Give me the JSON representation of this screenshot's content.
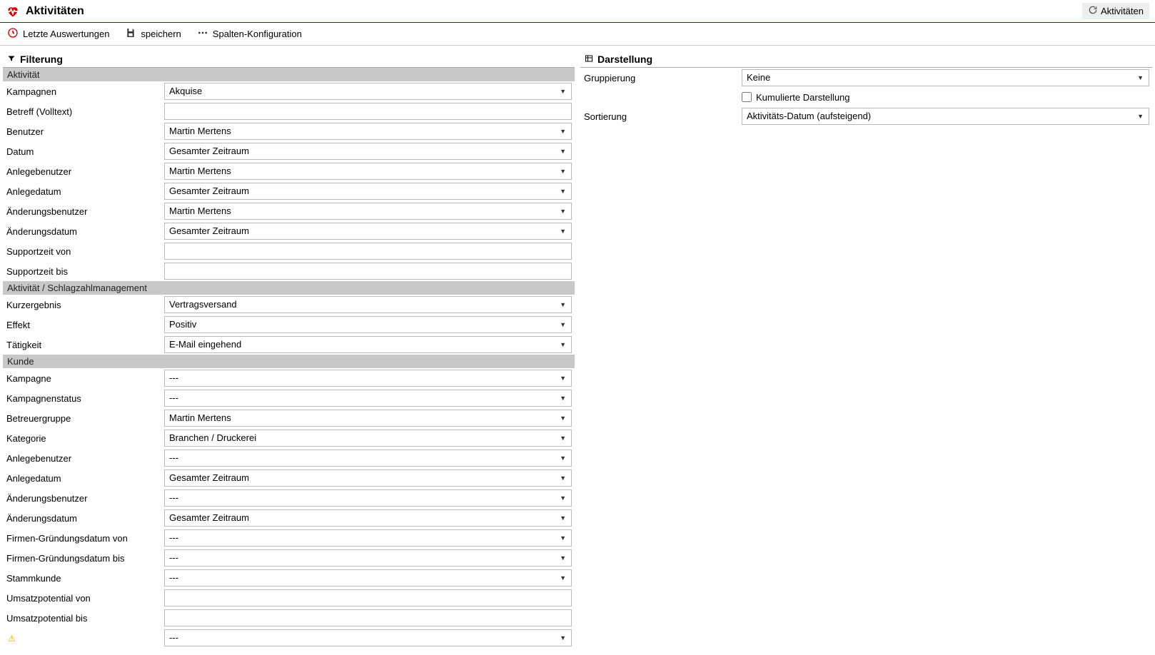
{
  "header": {
    "title": "Aktivitäten",
    "refresh_label": "Aktivitäten"
  },
  "toolbar": {
    "recent": "Letzte Auswertungen",
    "save": "speichern",
    "columns": "Spalten-Konfiguration"
  },
  "filter": {
    "section_title": "Filterung",
    "group_activity": "Aktivität",
    "campaigns_label": "Kampagnen",
    "campaigns_value": "Akquise",
    "subject_label": "Betreff (Volltext)",
    "subject_value": "",
    "user_label": "Benutzer",
    "user_value": "Martin Mertens",
    "date_label": "Datum",
    "date_value": "Gesamter Zeitraum",
    "createduser_label": "Anlegebenutzer",
    "createduser_value": "Martin Mertens",
    "createddate_label": "Anlegedatum",
    "createddate_value": "Gesamter Zeitraum",
    "changeuser_label": "Änderungsbenutzer",
    "changeuser_value": "Martin Mertens",
    "changedate_label": "Änderungsdatum",
    "changedate_value": "Gesamter Zeitraum",
    "supportfrom_label": "Supportzeit von",
    "supportfrom_value": "",
    "supportto_label": "Supportzeit bis",
    "supportto_value": "",
    "group_strike": "Aktivität / Schlagzahlmanagement",
    "shortresult_label": "Kurzergebnis",
    "shortresult_value": "Vertragsversand",
    "effect_label": "Effekt",
    "effect_value": "Positiv",
    "task_label": "Tätigkeit",
    "task_value": "E-Mail eingehend",
    "group_customer": "Kunde",
    "kcampaign_label": "Kampagne",
    "kcampaign_value": "---",
    "kcampaignstatus_label": "Kampagnenstatus",
    "kcampaignstatus_value": "---",
    "caregroup_label": "Betreuergruppe",
    "caregroup_value": "Martin Mertens",
    "category_label": "Kategorie",
    "category_value": "Branchen / Druckerei",
    "kcreateduser_label": "Anlegebenutzer",
    "kcreateduser_value": "---",
    "kcreateddate_label": "Anlegedatum",
    "kcreateddate_value": "Gesamter Zeitraum",
    "kchangeuser_label": "Änderungsbenutzer",
    "kchangeuser_value": "---",
    "kchangedate_label": "Änderungsdatum",
    "kchangedate_value": "Gesamter Zeitraum",
    "foundingfrom_label": "Firmen-Gründungsdatum von",
    "foundingfrom_value": "---",
    "foundingto_label": "Firmen-Gründungsdatum bis",
    "foundingto_value": "---",
    "regular_label": "Stammkunde",
    "regular_value": "---",
    "revpotfrom_label": "Umsatzpotential von",
    "revpotfrom_value": "",
    "revpotto_label": "Umsatzpotential bis",
    "revpotto_value": "",
    "warn_value": "---"
  },
  "display": {
    "section_title": "Darstellung",
    "grouping_label": "Gruppierung",
    "grouping_value": "Keine",
    "cumulative_label": "Kumulierte Darstellung",
    "sorting_label": "Sortierung",
    "sorting_value": "Aktivitäts-Datum (aufsteigend)"
  }
}
